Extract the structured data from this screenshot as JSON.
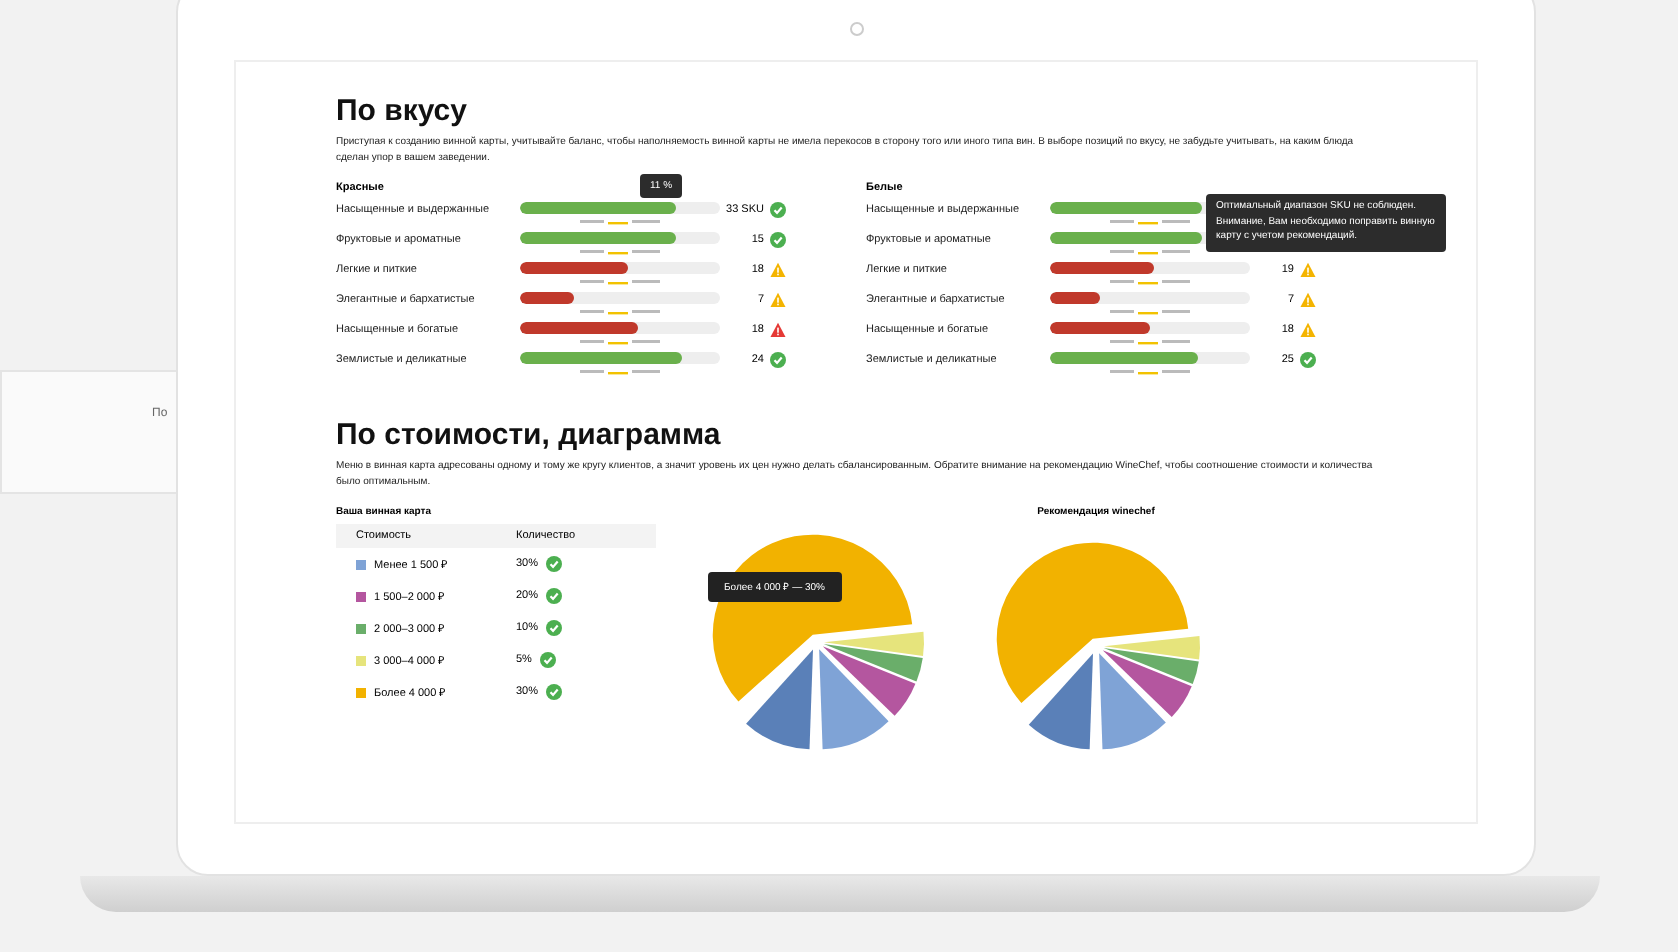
{
  "background_card": {
    "text": "По"
  },
  "taste": {
    "title": "По вкусу",
    "description": "Приступая к созданию винной карты, учитывайте баланс, чтобы наполняемость винной карты не имела перекосов в сторону того или иного типа вин. В выборе позиций по вкусу, не забудьте учитывать, на каким блюда сделан упор в вашем заведении.",
    "groups": [
      {
        "title": "Красные",
        "rows": [
          {
            "label": "Насыщенные и выдержанные",
            "level": 0.78,
            "value": "33 SKU",
            "kind": "ok",
            "tooltip": "11 %"
          },
          {
            "label": "Фруктовые и ароматные",
            "level": 0.78,
            "value": "15",
            "kind": "ok"
          },
          {
            "label": "Легкие и питкие",
            "level": 0.54,
            "value": "18",
            "kind": "warn"
          },
          {
            "label": "Элегантные и бархатистые",
            "level": 0.27,
            "value": "7",
            "kind": "warn"
          },
          {
            "label": "Насыщенные и богатые",
            "level": 0.59,
            "value": "18",
            "kind": "alert"
          },
          {
            "label": "Землистые и деликатные",
            "level": 0.81,
            "value": "24",
            "kind": "ok"
          }
        ]
      },
      {
        "title": "Белые",
        "rows": [
          {
            "label": "Насыщенные и выдержанные",
            "level": 0.76,
            "kind": "ok"
          },
          {
            "label": "Фруктовые и ароматные",
            "level": 0.76,
            "kind": "ok",
            "tooltip": "Оптимальный диапазон SKU не соблюден. Внимание, Вам необходимо поправить винную карту с учетом рекомендаций."
          },
          {
            "label": "Легкие и питкие",
            "level": 0.52,
            "value": "19",
            "kind": "warn"
          },
          {
            "label": "Элегантные и бархатистые",
            "level": 0.25,
            "value": "7",
            "kind": "warn"
          },
          {
            "label": "Насыщенные и богатые",
            "level": 0.5,
            "value": "18",
            "kind": "warn"
          },
          {
            "label": "Землистые и деликатные",
            "level": 0.74,
            "value": "25",
            "kind": "ok"
          }
        ]
      }
    ]
  },
  "cost": {
    "title": "По стоимости, диаграмма",
    "description": "Меню в винная карта адресованы одному и тому же кругу клиентов, а значит уровень их цен нужно делать сбалансированным. Обратите внимание на рекомендацию WineChef, чтобы соотношение стоимости и количества было оптимальным.",
    "table": {
      "title": "Ваша винная карта",
      "columns": [
        "Стоимость",
        "Количество"
      ],
      "rows": [
        {
          "price": "Менее 1 500 ₽",
          "share": "30%",
          "color": "#7fa3d6"
        },
        {
          "price": "1 500–2 000 ₽",
          "share": "20%",
          "color": "#b4569f"
        },
        {
          "price": "2 000–3 000 ₽",
          "share": "10%",
          "color": "#6aae6a"
        },
        {
          "price": "3 000–4 000 ₽",
          "share": "5%",
          "color": "#e6e47c"
        },
        {
          "price": "Более 4 000 ₽",
          "share": "30%",
          "color": "#f2b200"
        }
      ]
    },
    "pie_tooltip": "Более 4 000 ₽ — 30%",
    "recommendation_title": "Рекомендация winechef"
  }
}
